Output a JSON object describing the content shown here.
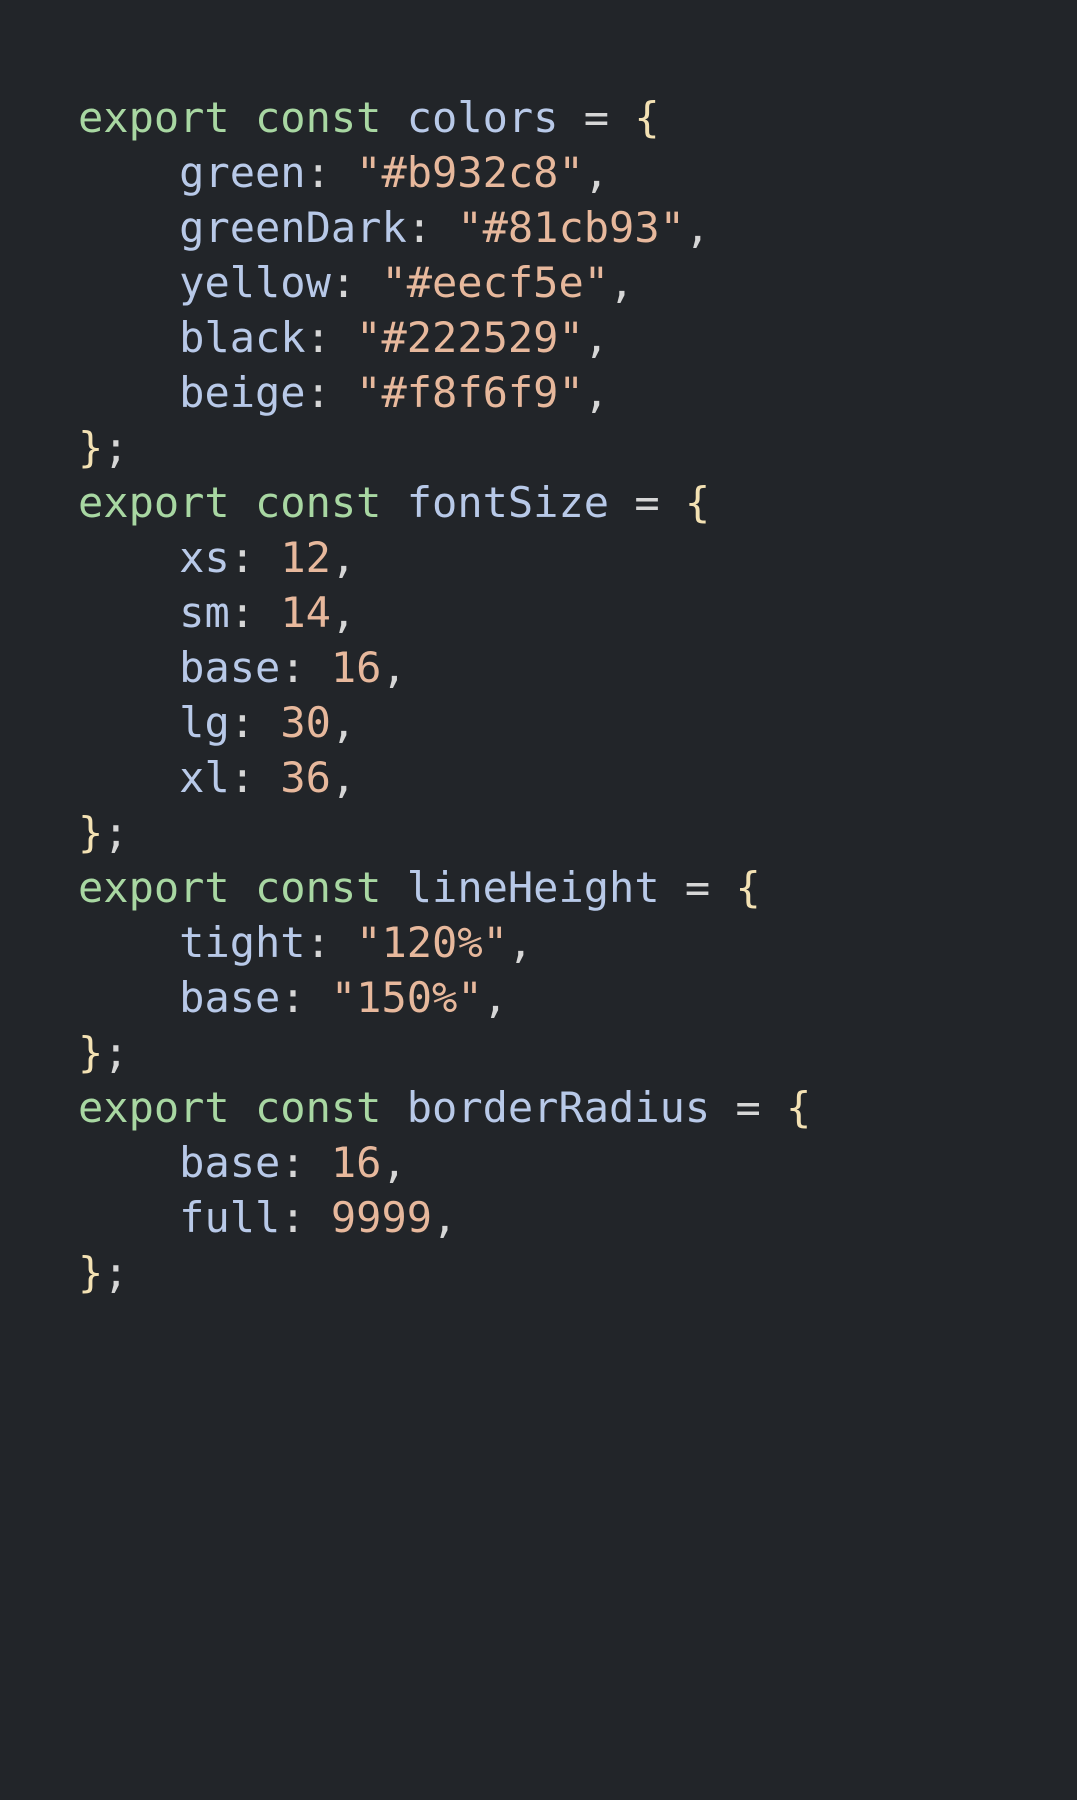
{
  "kw_export": "export",
  "kw_const": "const",
  "eq": " = ",
  "ob": "{",
  "cb": "}",
  "semi": ";",
  "comma": ",",
  "colon": ": ",
  "indent": "    ",
  "decl": {
    "colors": {
      "name": "colors",
      "entries": [
        {
          "key": "green",
          "val": "\"#b932c8\"",
          "cls": "st"
        },
        {
          "key": "greenDark",
          "val": "\"#81cb93\"",
          "cls": "st"
        },
        {
          "key": "yellow",
          "val": "\"#eecf5e\"",
          "cls": "st"
        },
        {
          "key": "black",
          "val": "\"#222529\"",
          "cls": "st"
        },
        {
          "key": "beige",
          "val": "\"#f8f6f9\"",
          "cls": "st"
        }
      ]
    },
    "fontSize": {
      "name": "fontSize",
      "entries": [
        {
          "key": "xs",
          "val": "12",
          "cls": "nu"
        },
        {
          "key": "sm",
          "val": "14",
          "cls": "nu"
        },
        {
          "key": "base",
          "val": "16",
          "cls": "nu"
        },
        {
          "key": "lg",
          "val": "30",
          "cls": "nu"
        },
        {
          "key": "xl",
          "val": "36",
          "cls": "nu"
        }
      ]
    },
    "lineHeight": {
      "name": "lineHeight",
      "entries": [
        {
          "key": "tight",
          "val": "\"120%\"",
          "cls": "st"
        },
        {
          "key": "base",
          "val": "\"150%\"",
          "cls": "st"
        }
      ]
    },
    "borderRadius": {
      "name": "borderRadius",
      "entries": [
        {
          "key": "base",
          "val": "16",
          "cls": "nu"
        },
        {
          "key": "full",
          "val": "9999",
          "cls": "nu"
        }
      ]
    }
  },
  "order": [
    "colors",
    "fontSize",
    "lineHeight",
    "borderRadius"
  ]
}
